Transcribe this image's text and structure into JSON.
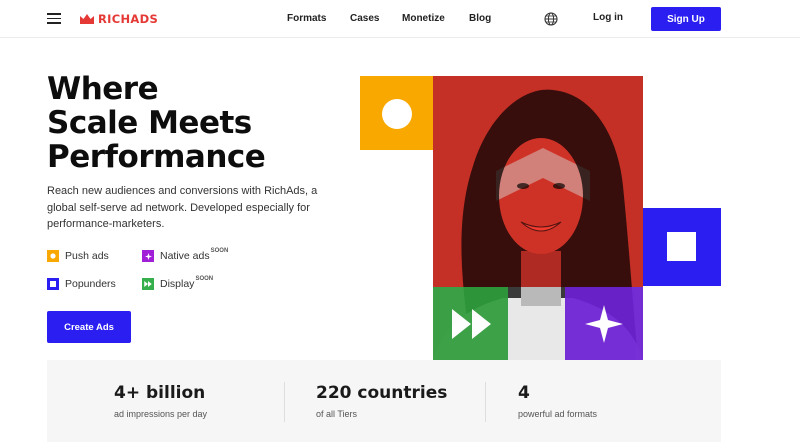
{
  "brand": {
    "name": "RICHADS",
    "color": "#e53935"
  },
  "nav": {
    "items": [
      "Formats",
      "Cases",
      "Monetize",
      "Blog"
    ]
  },
  "header": {
    "login": "Log in",
    "signup": "Sign Up",
    "globe_icon": "globe-icon",
    "menu_icon": "hamburger-menu-icon"
  },
  "hero": {
    "headline": [
      "Where",
      "Scale Meets",
      "Performance"
    ],
    "description": "Reach new audiences and conversions with RichAds, a global self-serve ad network. Developed especially for performance-marketers.",
    "formats": [
      {
        "label": "Push ads",
        "soon": ""
      },
      {
        "label": "Native ads",
        "soon": "SOON"
      },
      {
        "label": "Popunders",
        "soon": ""
      },
      {
        "label": "Display",
        "soon": "SOON"
      }
    ],
    "cta": "Create Ads"
  },
  "stats": [
    {
      "value": "4+ billion",
      "label": "ad impressions per day"
    },
    {
      "value": "220 countries",
      "label": "of all Tiers"
    },
    {
      "value": "4",
      "label": "powerful ad formats"
    }
  ],
  "colors": {
    "accent": "#2a1ef0",
    "yellow": "#f9a800",
    "red": "#f23a2e",
    "green": "#2e9c3a",
    "purple": "#6c1ed4"
  }
}
